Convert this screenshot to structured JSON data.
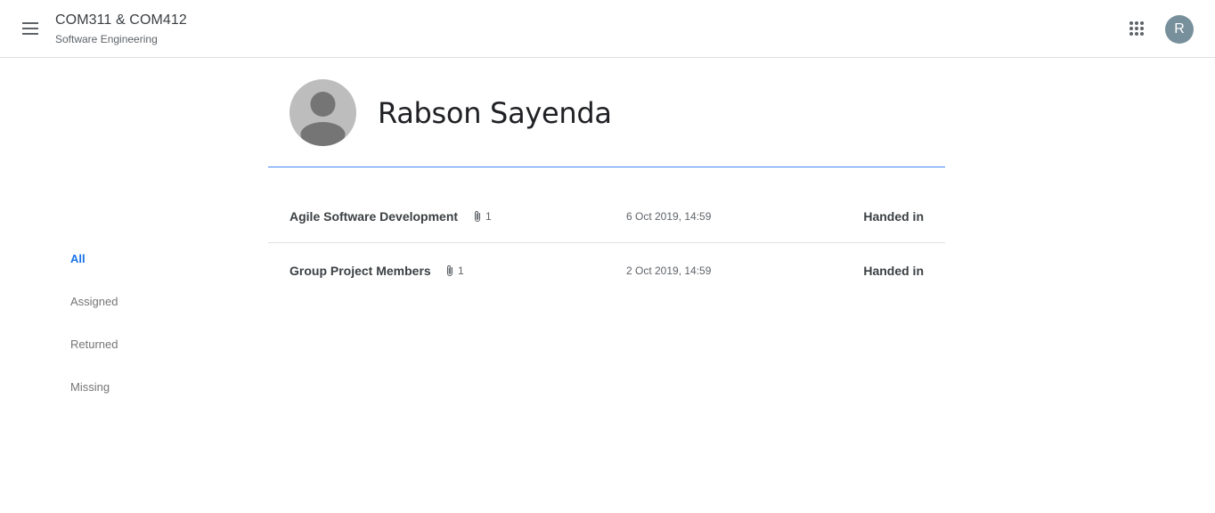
{
  "header": {
    "class_title": "COM311 & COM412",
    "class_subtitle": "Software Engineering",
    "account_initial": "R"
  },
  "student": {
    "name": "Rabson Sayenda"
  },
  "filters": [
    {
      "label": "All",
      "selected": true
    },
    {
      "label": "Assigned",
      "selected": false
    },
    {
      "label": "Returned",
      "selected": false
    },
    {
      "label": "Missing",
      "selected": false
    }
  ],
  "work": [
    {
      "title": "Agile Software Development",
      "attachments": "1",
      "date": "6 Oct 2019, 14:59",
      "status": "Handed in"
    },
    {
      "title": "Group Project Members",
      "attachments": "1",
      "date": "2 Oct 2019, 14:59",
      "status": "Handed in"
    }
  ],
  "colors": {
    "accent": "#1a73e8",
    "rule": "#4285f4",
    "avatar_bg": "#78909c"
  }
}
